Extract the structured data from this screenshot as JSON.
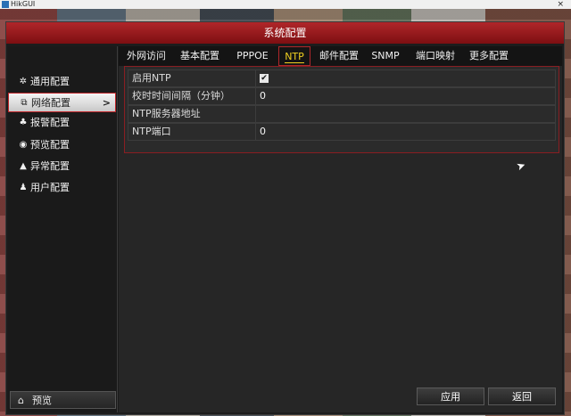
{
  "app": {
    "title": "HikGUI",
    "close": "×"
  },
  "window": {
    "title": "系统配置"
  },
  "sidebar": {
    "items": [
      {
        "label": "通用配置",
        "icon": "gear-icon",
        "glyph": "✲"
      },
      {
        "label": "网络配置",
        "icon": "network-icon",
        "glyph": "⧉",
        "arrow": ">"
      },
      {
        "label": "报警配置",
        "icon": "bell-icon",
        "glyph": "♣"
      },
      {
        "label": "预览配置",
        "icon": "eye-icon",
        "glyph": "◉"
      },
      {
        "label": "异常配置",
        "icon": "warning-icon",
        "glyph": "▲"
      },
      {
        "label": "用户配置",
        "icon": "users-icon",
        "glyph": "♟"
      }
    ],
    "bottom": {
      "label": "预览",
      "icon": "home-icon",
      "glyph": "⌂"
    }
  },
  "tabs": [
    "外网访问",
    "基本配置",
    "PPPOE",
    "NTP",
    "邮件配置",
    "SNMP",
    "端口映射",
    "更多配置"
  ],
  "active_tab": "NTP",
  "form": {
    "enable_ntp": {
      "label": "启用NTP",
      "checked": true,
      "mark": "✔"
    },
    "sync_interval": {
      "label": "校时时间间隔（分钟）",
      "value": "0"
    },
    "ntp_server": {
      "label": "NTP服务器地址",
      "value": ""
    },
    "ntp_port": {
      "label": "NTP端口",
      "value": "0"
    }
  },
  "buttons": {
    "apply": "应用",
    "back": "返回"
  },
  "colors": {
    "accent": "#b0262a",
    "active_tab": "#f0d020"
  }
}
